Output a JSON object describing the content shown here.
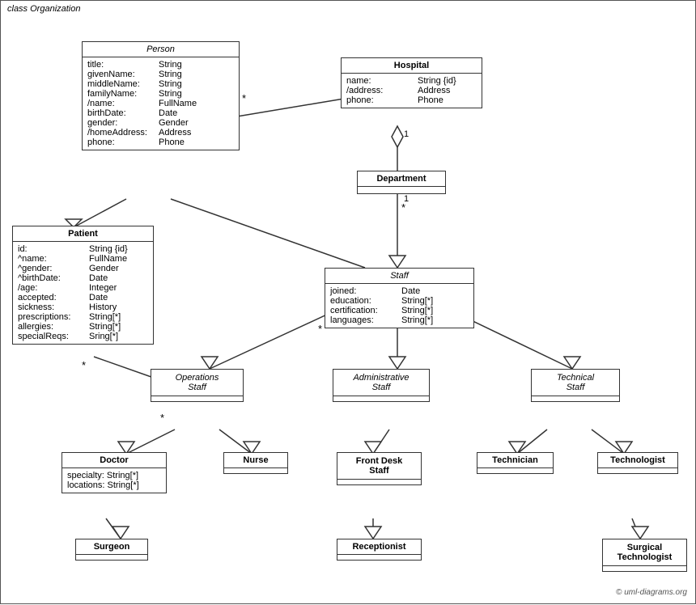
{
  "diagram": {
    "title": "class Organization",
    "copyright": "© uml-diagrams.org"
  },
  "classes": {
    "person": {
      "title": "Person",
      "italic": true,
      "attrs": [
        {
          "name": "title:",
          "type": "String"
        },
        {
          "name": "givenName:",
          "type": "String"
        },
        {
          "name": "middleName:",
          "type": "String"
        },
        {
          "name": "familyName:",
          "type": "String"
        },
        {
          "name": "/name:",
          "type": "FullName"
        },
        {
          "name": "birthDate:",
          "type": "Date"
        },
        {
          "name": "gender:",
          "type": "Gender"
        },
        {
          "name": "/homeAddress:",
          "type": "Address"
        },
        {
          "name": "phone:",
          "type": "Phone"
        }
      ]
    },
    "hospital": {
      "title": "Hospital",
      "italic": false,
      "attrs": [
        {
          "name": "name:",
          "type": "String {id}"
        },
        {
          "name": "/address:",
          "type": "Address"
        },
        {
          "name": "phone:",
          "type": "Phone"
        }
      ]
    },
    "patient": {
      "title": "Patient",
      "italic": false,
      "attrs": [
        {
          "name": "id:",
          "type": "String {id}"
        },
        {
          "name": "^name:",
          "type": "FullName"
        },
        {
          "name": "^gender:",
          "type": "Gender"
        },
        {
          "name": "^birthDate:",
          "type": "Date"
        },
        {
          "name": "/age:",
          "type": "Integer"
        },
        {
          "name": "accepted:",
          "type": "Date"
        },
        {
          "name": "sickness:",
          "type": "History"
        },
        {
          "name": "prescriptions:",
          "type": "String[*]"
        },
        {
          "name": "allergies:",
          "type": "String[*]"
        },
        {
          "name": "specialReqs:",
          "type": "Sring[*]"
        }
      ]
    },
    "department": {
      "title": "Department",
      "italic": false,
      "attrs": []
    },
    "staff": {
      "title": "Staff",
      "italic": true,
      "attrs": [
        {
          "name": "joined:",
          "type": "Date"
        },
        {
          "name": "education:",
          "type": "String[*]"
        },
        {
          "name": "certification:",
          "type": "String[*]"
        },
        {
          "name": "languages:",
          "type": "String[*]"
        }
      ]
    },
    "operations_staff": {
      "title": "Operations Staff",
      "italic": true,
      "attrs": []
    },
    "administrative_staff": {
      "title": "Administrative Staff",
      "italic": true,
      "attrs": []
    },
    "technical_staff": {
      "title": "Technical Staff",
      "italic": true,
      "attrs": []
    },
    "doctor": {
      "title": "Doctor",
      "italic": false,
      "attrs": [
        {
          "name": "specialty:",
          "type": "String[*]"
        },
        {
          "name": "locations:",
          "type": "String[*]"
        }
      ]
    },
    "nurse": {
      "title": "Nurse",
      "italic": false,
      "attrs": []
    },
    "front_desk_staff": {
      "title": "Front Desk Staff",
      "italic": false,
      "attrs": []
    },
    "technician": {
      "title": "Technician",
      "italic": false,
      "attrs": []
    },
    "technologist": {
      "title": "Technologist",
      "italic": false,
      "attrs": []
    },
    "surgeon": {
      "title": "Surgeon",
      "italic": false,
      "attrs": []
    },
    "receptionist": {
      "title": "Receptionist",
      "italic": false,
      "attrs": []
    },
    "surgical_technologist": {
      "title": "Surgical Technologist",
      "italic": false,
      "attrs": []
    }
  }
}
